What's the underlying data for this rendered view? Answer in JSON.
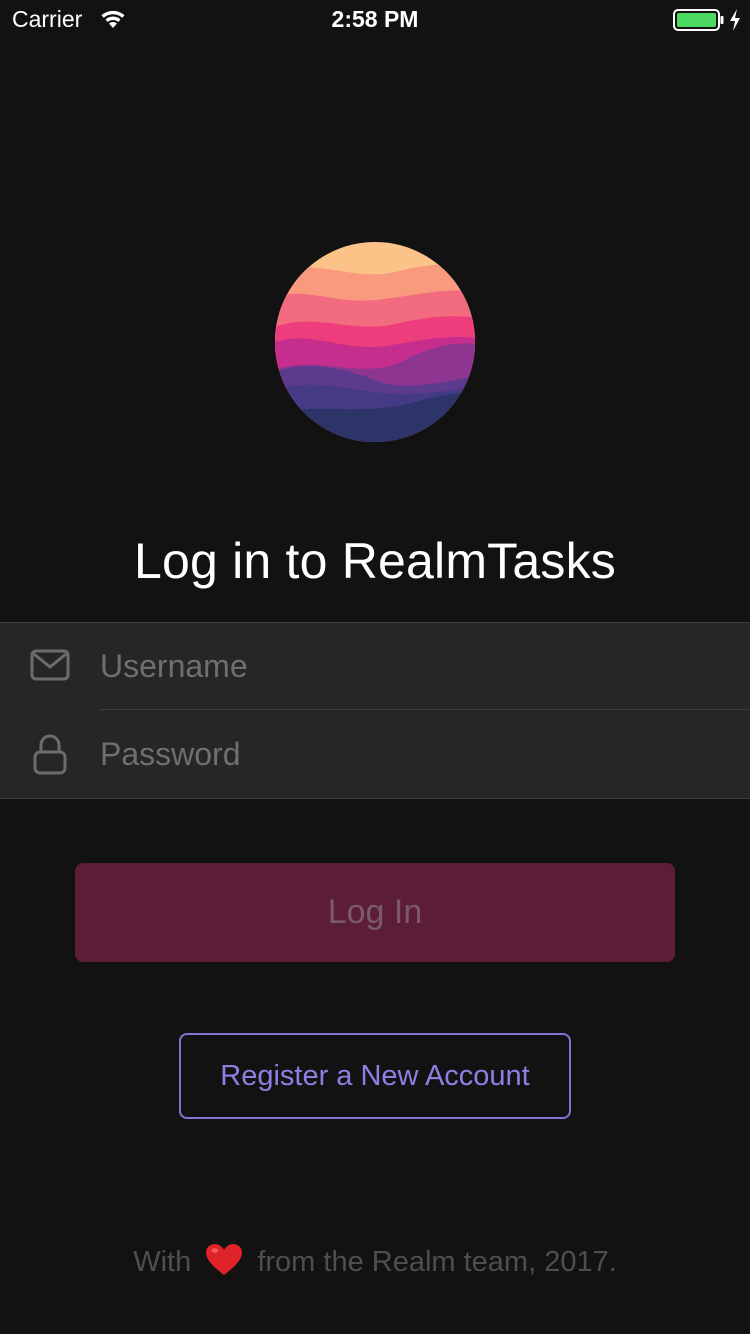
{
  "status_bar": {
    "carrier": "Carrier",
    "time": "2:58 PM",
    "battery_color": "#4cd964"
  },
  "title": "Log in to RealmTasks",
  "form": {
    "username_placeholder": "Username",
    "username_value": "",
    "username_icon": "mail-icon",
    "password_placeholder": "Password",
    "password_value": "",
    "password_icon": "lock-icon"
  },
  "buttons": {
    "login_label": "Log In",
    "register_label": "Register a New Account"
  },
  "footer": {
    "prefix": "With",
    "icon": "heart-icon",
    "suffix": "from the Realm team, 2017."
  },
  "colors": {
    "background": "#121212",
    "login_button": "#5c1e36",
    "register_accent": "#8c80e4",
    "heart": "#e0222a"
  }
}
